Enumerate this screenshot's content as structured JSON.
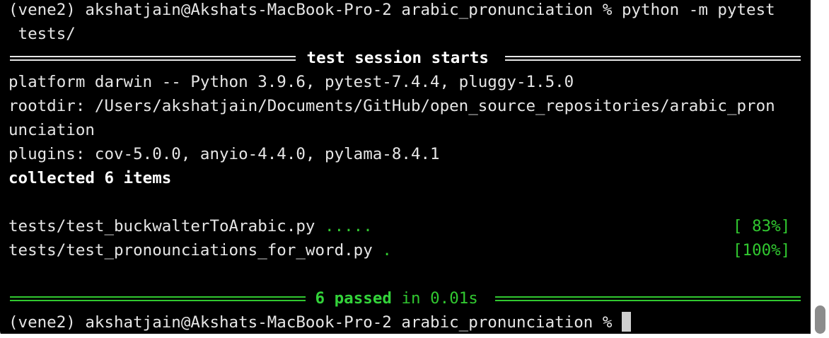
{
  "terminal": {
    "prompt_command_line1": "(vene2) akshatjain@Akshats-MacBook-Pro-2 arabic_pronunciation % python -m pytest",
    "prompt_command_line2": " tests/",
    "session_header": " test session starts ",
    "platform_line": "platform darwin -- Python 3.9.6, pytest-7.4.4, pluggy-1.5.0",
    "rootdir_line1": "rootdir: /Users/akshatjain/Documents/GitHub/open_source_repositories/arabic_pron",
    "rootdir_line2": "unciation",
    "plugins_line": "plugins: cov-5.0.0, anyio-4.4.0, pylama-8.4.1",
    "collected_line": "collected 6 items",
    "results": [
      {
        "file": "tests/test_buckwalterToArabic.py ",
        "dots": ".....",
        "percent": "[ 83%]"
      },
      {
        "file": "tests/test_pronounciations_for_word.py ",
        "dots": ".",
        "percent": "[100%]"
      }
    ],
    "summary_passed": " 6 passed",
    "summary_time": " in 0.01s ",
    "final_prompt": "(vene2) akshatjain@Akshats-MacBook-Pro-2 arabic_pronunciation % "
  },
  "colors": {
    "background": "#000000",
    "text": "#e6e6e6",
    "green": "#31c830"
  }
}
